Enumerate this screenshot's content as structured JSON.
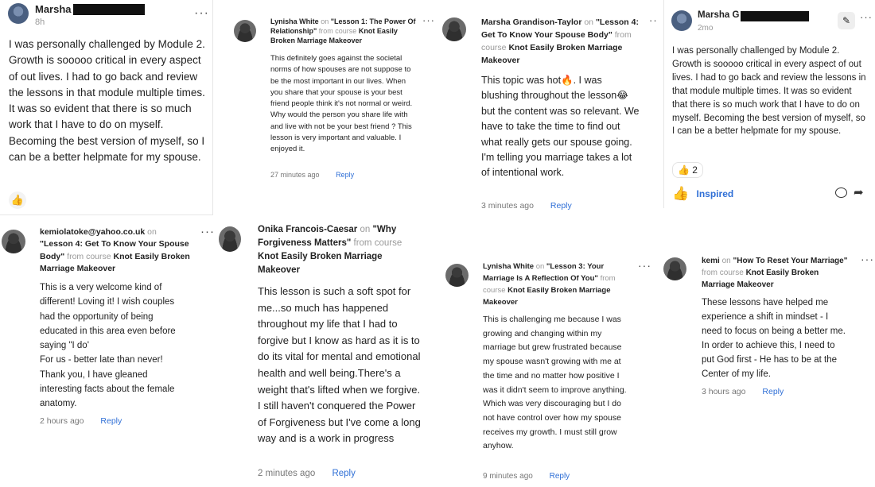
{
  "c1": {
    "name": "Marsha G",
    "time": "8h",
    "body": "I was personally challenged by Module 2. Growth is sooooo critical in every aspect of out lives. I had to go back and review the lessons in that module multiple times. It was so evident that there is so much work that I have to do on myself. Becoming the best version of myself, so I can be a better helpmate for my spouse.",
    "react_icon": "👍"
  },
  "c2": {
    "name": "Lynisha White",
    "on": "on",
    "lesson": "\"Lesson 1: The Power Of Relationship\"",
    "from": "from course",
    "course": "Knot Easily Broken Marriage Makeover",
    "body": "This definitely goes against the societal norms of how spouses are not suppose to be the most important in our lives. When you share that your spouse is your best friend people think it's not normal or weird. Why would the person you share life with and live with not be your best friend ? This lesson is very important and valuable. I enjoyed it.",
    "time": "27 minutes ago",
    "reply": "Reply"
  },
  "c3": {
    "name": "Marsha Grandison-Taylor",
    "on": "on",
    "lesson": "\"Lesson 4: Get To Know Your Spouse Body\"",
    "from": "from course",
    "course": "Knot Easily Broken Marriage Makeover",
    "body1": "This topic was hot🔥. I was blushing throughout the lesson😂 but the content was so relevant. We have to take the time to find out what really gets our spouse going.",
    "body2": "I'm telling you marriage takes a lot of intentional work.",
    "time": "3 minutes ago",
    "reply": "Reply"
  },
  "c4": {
    "name": "Marsha G",
    "time": "2mo",
    "body": "I was personally challenged by Module 2. Growth is sooooo critical in every aspect of out lives. I had to go back and review the lessons in that module multiple times. It was so evident that there is so much work that I have to do on myself. Becoming the best version of myself, so I can be a better helpmate for my spouse.",
    "reaction_count": "2",
    "inspired": "Inspired"
  },
  "c5": {
    "name": "kemiolatoke@yahoo.co.uk",
    "on": "on",
    "lesson": "\"Lesson 4: Get To Know Your Spouse Body\"",
    "from": "from course",
    "course": "Knot Easily Broken Marriage Makeover",
    "body1": "This is a very welcome kind of different! Loving it! I wish couples had the opportunity of being educated in this area even before saying \"I do'",
    "body2": "For us - better late than never!",
    "body3": "Thank you, I have gleaned interesting facts about the female anatomy.",
    "time": "2 hours ago",
    "reply": "Reply"
  },
  "c6": {
    "name": "Onika Francois-Caesar",
    "on": "on",
    "lesson": "\"Why Forgiveness Matters\"",
    "from": "from course",
    "course": "Knot Easily Broken Marriage Makeover",
    "body": "This lesson is such a soft spot for me...so much has happened throughout my life that I had to forgive but I know as hard as it is to do its vital for mental and emotional health and well being.There's a weight that's lifted when we forgive. I still haven't conquered the Power of Forgiveness but I've come a long way and is a work in progress",
    "time": "2 minutes ago",
    "reply": "Reply"
  },
  "c7": {
    "name": "Lynisha White",
    "on": "on",
    "lesson": "\"Lesson 3: Your Marriage Is A Reflection Of You\"",
    "from": "from course",
    "course": "Knot Easily Broken Marriage Makeover",
    "body": "This is challenging me because I was growing and changing within my marriage but grew frustrated because my spouse wasn't growing with me at the time and no matter how positive I was it didn't seem to improve anything. Which was very discouraging but I do not have control over how my spouse receives my growth. I must still grow anyhow.",
    "time": "9 minutes ago",
    "reply": "Reply"
  },
  "c8": {
    "name": "kemi",
    "on": "on",
    "lesson": "\"How To Reset Your Marriage\"",
    "from": "from course",
    "course": "Knot Easily Broken Marriage Makeover",
    "body": "These lessons have helped me experience a shift in mindset - I need to focus on being a better me. In order to achieve this, I need to put God first - He has to be at the Center of my life.",
    "time": "3 hours ago",
    "reply": "Reply"
  },
  "menu_glyph": "···",
  "icons": [
    "thumbs-up-icon",
    "comment-icon",
    "share-icon",
    "pin-icon",
    "more-icon"
  ]
}
